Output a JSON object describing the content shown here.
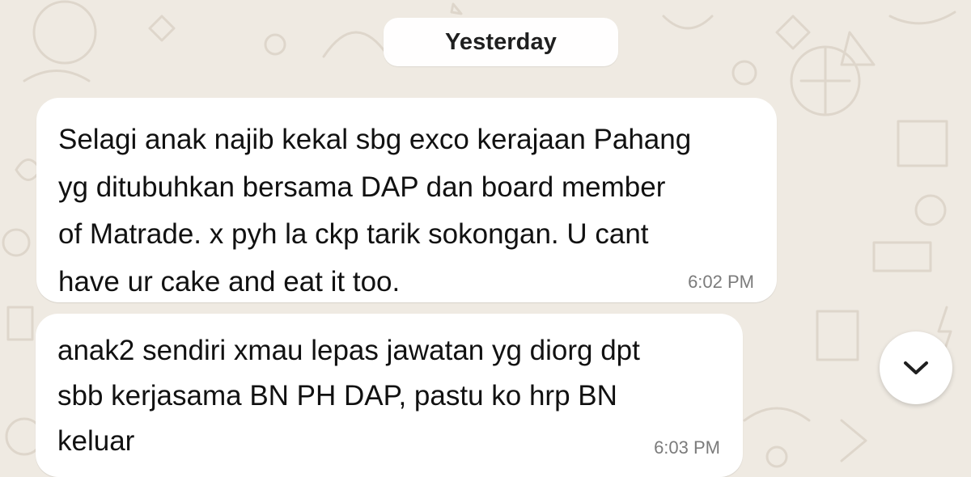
{
  "chat": {
    "date_separator": "Yesterday",
    "messages": [
      {
        "lines": [
          "Selagi anak najib kekal sbg exco kerajaan Pahang",
          "yg ditubuhkan bersama DAP dan board member",
          "of Matrade. x pyh la ckp tarik sokongan. U cant",
          "have ur cake and eat it too."
        ],
        "time": "6:02 PM"
      },
      {
        "lines": [
          "anak2 sendiri xmau lepas jawatan yg diorg dpt",
          "sbb kerjasama BN PH DAP, pastu ko hrp BN",
          "keluar"
        ],
        "time": "6:03 PM"
      }
    ]
  },
  "controls": {
    "scroll_down_icon": "chevron-down-icon"
  },
  "colors": {
    "background": "#efeae2",
    "bubble": "#ffffff",
    "text": "#111111",
    "timestamp": "#7b7b7b"
  }
}
